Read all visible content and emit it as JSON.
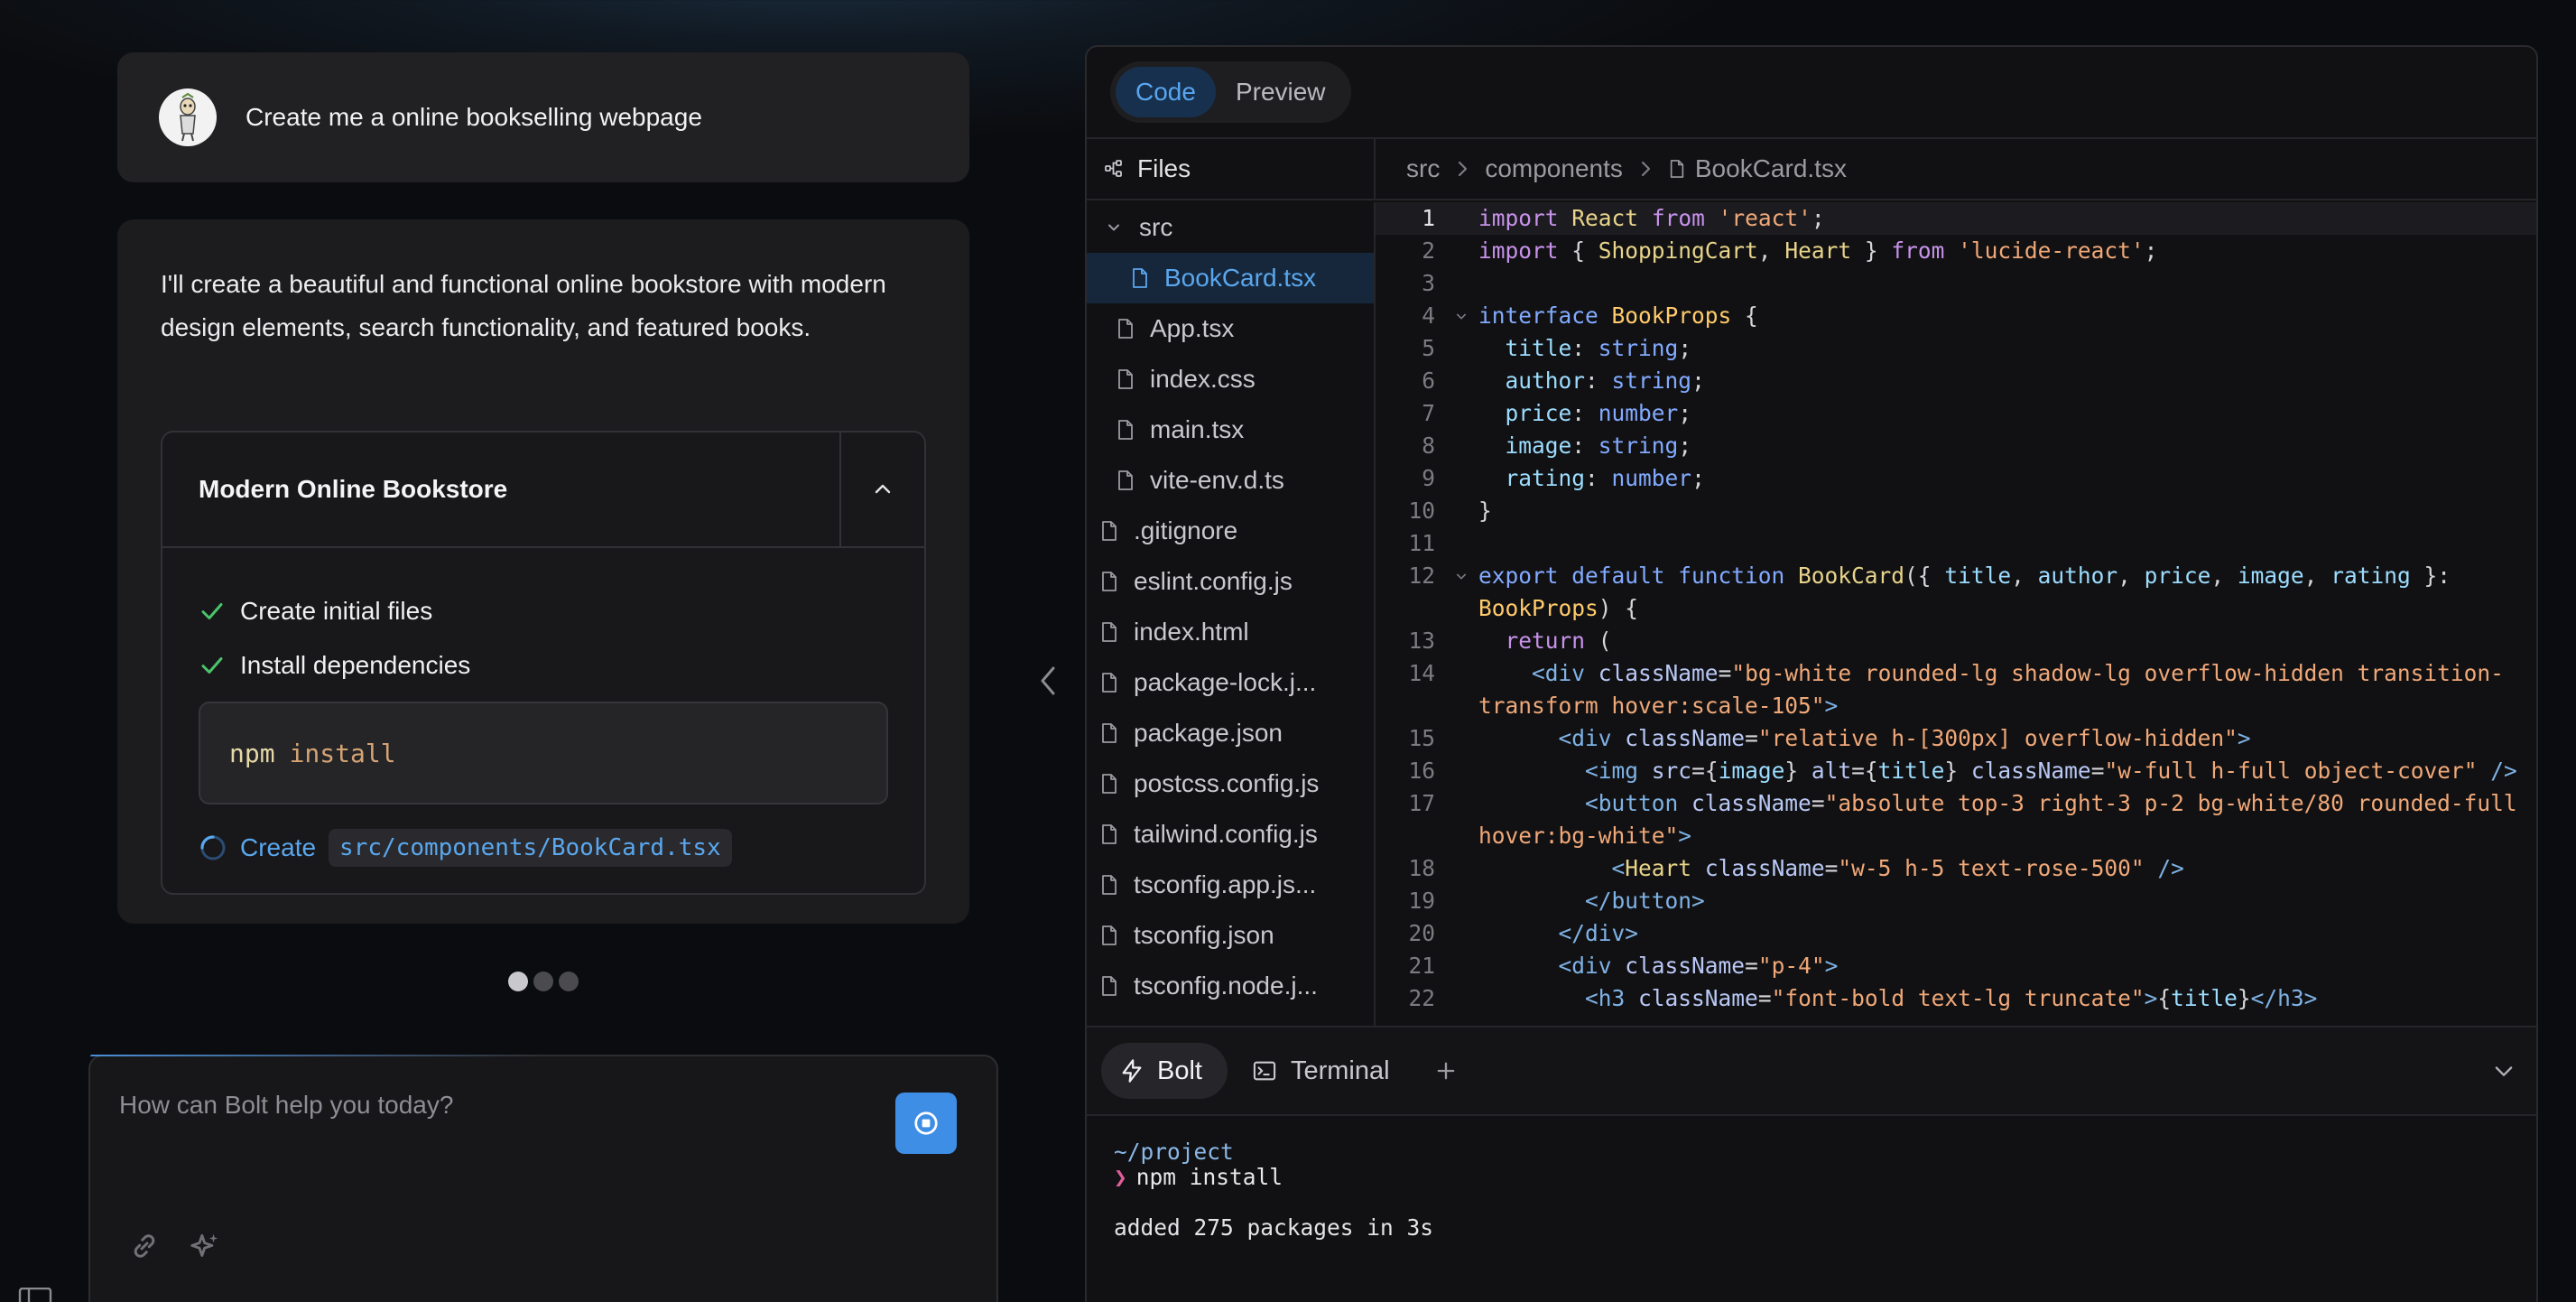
{
  "chat": {
    "user_message": "Create me a online bookselling webpage",
    "assistant_message": "I'll create a beautiful and functional online bookstore with modern design elements, search functionality, and featured books.",
    "artifact": {
      "title": "Modern Online Bookstore",
      "steps": [
        {
          "label": "Create initial files",
          "status": "done"
        },
        {
          "label": "Install dependencies",
          "status": "done"
        },
        {
          "label": "Create",
          "status": "in-progress",
          "path": "src/components/BookCard.tsx"
        }
      ],
      "command": {
        "keyword": "npm",
        "argument": "install"
      }
    },
    "carousel_dots": 3,
    "carousel_active": 0,
    "input_placeholder": "How can Bolt help you today?"
  },
  "workbench": {
    "tabs": [
      "Code",
      "Preview"
    ],
    "active_tab": "Code",
    "files_label": "Files",
    "tree": [
      {
        "name": "src",
        "type": "folder"
      },
      {
        "name": "BookCard.tsx",
        "type": "file",
        "selected": true
      },
      {
        "name": "App.tsx",
        "type": "file"
      },
      {
        "name": "index.css",
        "type": "file"
      },
      {
        "name": "main.tsx",
        "type": "file"
      },
      {
        "name": "vite-env.d.ts",
        "type": "file"
      },
      {
        "name": ".gitignore",
        "type": "file"
      },
      {
        "name": "eslint.config.js",
        "type": "file"
      },
      {
        "name": "index.html",
        "type": "file"
      },
      {
        "name": "package-lock.j...",
        "type": "file"
      },
      {
        "name": "package.json",
        "type": "file"
      },
      {
        "name": "postcss.config.js",
        "type": "file"
      },
      {
        "name": "tailwind.config.js",
        "type": "file"
      },
      {
        "name": "tsconfig.app.js...",
        "type": "file"
      },
      {
        "name": "tsconfig.json",
        "type": "file"
      },
      {
        "name": "tsconfig.node.j...",
        "type": "file"
      }
    ],
    "breadcrumb": [
      "src",
      "components",
      "BookCard.tsx"
    ],
    "code_line_numbers": [
      "1",
      "2",
      "3",
      "4",
      "5",
      "6",
      "7",
      "8",
      "9",
      "10",
      "11",
      "12",
      "",
      "13",
      "14",
      "",
      "15",
      "16",
      "17",
      "",
      "18",
      "19",
      "20",
      "21",
      "22"
    ],
    "terminal": {
      "tabs": [
        "Bolt",
        "Terminal"
      ],
      "active_tab": "Bolt",
      "cwd": "~/project",
      "prompt_symbol": "❯",
      "command": "npm install",
      "output": "added 275 packages in 3s"
    }
  },
  "colors": {
    "accent": "#3f8ee5",
    "selected_text": "#5aa7ee",
    "background": "#0b0c0f"
  },
  "icons": [
    "avatar-logo",
    "check-icon",
    "spinner-icon",
    "chevron-up-icon",
    "chevron-left-icon",
    "stop-icon",
    "link-icon",
    "sparkle-icon",
    "files-tree-icon",
    "chevron-down-icon",
    "file-icon",
    "chevron-right-icon",
    "bolt-icon",
    "terminal-icon",
    "plus-icon",
    "sidebar-icon"
  ]
}
